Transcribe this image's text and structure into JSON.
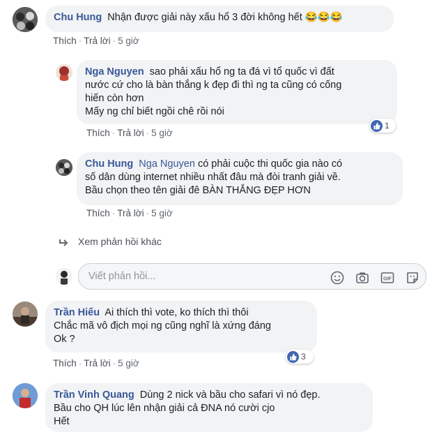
{
  "comments": [
    {
      "author": "Chu Hung",
      "text": "Nhận được giải này xấu hổ 3 đời không hết 😂😂😂",
      "actions": {
        "like": "Thích",
        "reply": "Trả lời",
        "time": "5 giờ"
      }
    },
    {
      "author": "Nga Nguyen",
      "lines": [
        "sao phải xấu hổ ng ta đá vì tổ quốc vì đất",
        "nước cứ cho là bàn thắng k đẹp đi thì ng ta cũng có cống",
        "hiến còn hơn",
        "Mấy ng chỉ biết ngồi chê rồi nói"
      ],
      "actions": {
        "like": "Thích",
        "reply": "Trả lời",
        "time": "5 giờ"
      },
      "reaction_count": "1"
    },
    {
      "author": "Chu Hung",
      "tag": "Nga Nguyen",
      "lines": [
        "có phải cuộc thi quốc gia nào có",
        "số dân dùng internet nhiều nhất đâu mà đòi tranh giải về.",
        "Bầu chọn theo tên giải đê BÀN THẮNG ĐẸP HƠN"
      ],
      "actions": {
        "like": "Thích",
        "reply": "Trả lời",
        "time": "5 giờ"
      }
    },
    {
      "author": "Trần Hiếu",
      "lines": [
        "Ai thích thì vote, ko thích thì thôi",
        "Chắc mã vô địch mọi ng cũng nghĩ là xứng đáng",
        "Ok ?"
      ],
      "actions": {
        "like": "Thích",
        "reply": "Trả lời",
        "time": "5 giờ"
      },
      "reaction_count": "3"
    },
    {
      "author": "Trần Vinh Quang",
      "lines": [
        "Dùng 2 nick và bầu cho safari vì nó đẹp.",
        "Bầu cho QH lúc lên nhận giải cả ĐNA nó cười cjo",
        "Hết"
      ]
    }
  ],
  "more_replies": "Xem phản hồi khác",
  "reply_input": {
    "placeholder": "Viết phản hồi..."
  },
  "icons": [
    "emoji-icon",
    "camera-icon",
    "gif-icon",
    "sticker-icon",
    "reply-arrow-icon",
    "like-icon"
  ],
  "colors": {
    "name": "#385898",
    "bubble": "#f2f3f5",
    "like": "#4267b2"
  }
}
